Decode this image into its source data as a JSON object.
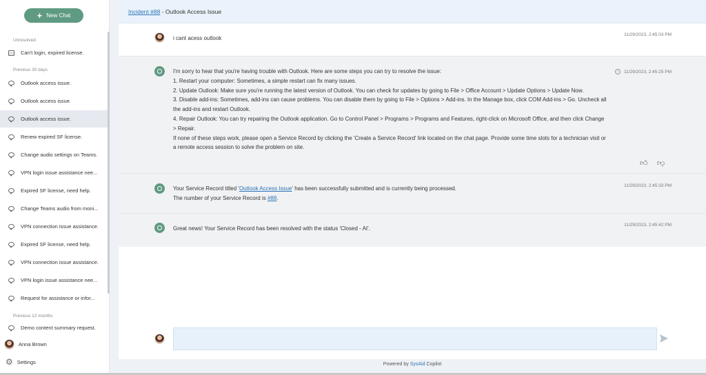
{
  "sidebar": {
    "new_chat_label": "New Chat",
    "sections": {
      "unresolved": "Unresolved",
      "previous_30": "Previous 30 days",
      "previous_12m": "Previous 12 months"
    },
    "unresolved_items": [
      {
        "label": "Can't login, expired license."
      }
    ],
    "items_30": [
      {
        "label": "Outlook access issue."
      },
      {
        "label": "Outlook access issue."
      },
      {
        "label": "Outlook access issue."
      },
      {
        "label": "Renew expired SF license."
      },
      {
        "label": "Change audio settings on Teams."
      },
      {
        "label": "VPN login issue assistance nee..."
      },
      {
        "label": "Expired SF license, need help."
      },
      {
        "label": "Change Teams audio from moni..."
      },
      {
        "label": "VPN connection issue assistance."
      },
      {
        "label": "Expired SF license, need help."
      },
      {
        "label": "VPN connection issue assistance."
      },
      {
        "label": "VPN login issue assistance nee..."
      },
      {
        "label": "Request for assistance or infor..."
      }
    ],
    "items_12m": [
      {
        "label": "Demo content summary request."
      }
    ],
    "user_name": "Anna Brown",
    "settings_label": "Settings"
  },
  "header": {
    "incident_link": "Incident #88",
    "title_suffix": " - Outlook Access Issue"
  },
  "messages": {
    "m1": {
      "text": "i cant acess outlook",
      "time": "11/29/2023, 2:45:03 PM"
    },
    "m2": {
      "time": "11/29/2023, 2:45:25 PM",
      "lines": [
        "I'm sorry to hear that you're having trouble with Outlook. Here are some steps you can try to resolve the issue:",
        "1. Restart your computer: Sometimes, a simple restart can fix many issues.",
        "2. Update Outlook: Make sure you're running the latest version of Outlook. You can check for updates by going to File > Office Account > Update Options > Update Now.",
        "3. Disable add-ins: Sometimes, add-ins can cause problems. You can disable them by going to File > Options > Add-ins. In the Manage box, click COM Add-ins > Go. Uncheck all the add-ins and restart Outlook.",
        "4. Repair Outlook: You can try repairing the Outlook application. Go to Control Panel > Programs > Programs and Features, right-click on Microsoft Office, and then click Change > Repair.",
        "If none of these steps work, please open a Service Record by clicking the 'Create a Service Record' link located on the chat page. Provide some time slots for a technician visit or a remote access session to solve the problem on site."
      ]
    },
    "m3": {
      "time": "11/29/2023, 2:45:33 PM",
      "pre": "Your Service Record titled '",
      "link": "Outlook Access Issue",
      "post": "' has been successfully submitted and is currently being processed.",
      "line2_pre": "The number of your Service Record is ",
      "line2_link": "#88",
      "line2_post": "."
    },
    "m4": {
      "time": "11/29/2023, 2:45:42 PM",
      "text": "Great news! Your Service Record has been resolved with the status 'Closed - AI'."
    }
  },
  "footer": {
    "prefix": "Powered by ",
    "brand": "SysAid",
    "suffix": " Copilot"
  },
  "colors": {
    "accent": "#5f9a82",
    "link": "#2a72b8",
    "header_bg": "#eaf3fb",
    "bot_bg": "#f1f2f4"
  },
  "icons": [
    "plus-icon",
    "chat-bubble-icon",
    "document-icon",
    "gear-icon",
    "bot-icon",
    "info-icon",
    "thumbs-up-icon",
    "thumbs-down-icon",
    "send-icon"
  ]
}
